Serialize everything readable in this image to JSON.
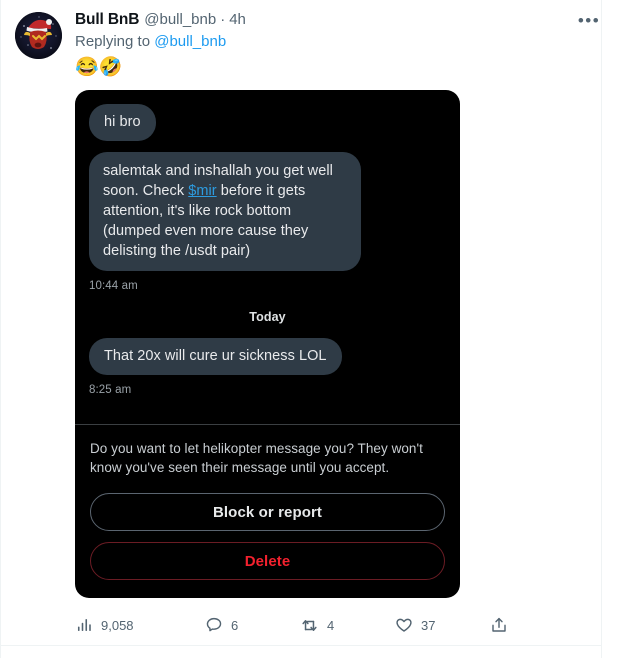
{
  "tweet": {
    "display_name": "Bull BnB",
    "handle": "@bull_bnb",
    "separator": "·",
    "timestamp": "4h",
    "more_label": "•••",
    "replying_prefix": "Replying to",
    "replying_handle": "@bull_bnb",
    "body_text": "😂🤣"
  },
  "media_card": {
    "messages": [
      {
        "text": "hi bro",
        "kind": "plain"
      },
      {
        "text_before_link": "salemtak and inshallah you get well soon. Check ",
        "link_text": "$mir",
        "text_after_link": " before it gets attention, it's like rock bottom (dumped even more cause they delisting the /usdt pair)",
        "kind": "with-link"
      }
    ],
    "first_time": "10:44 am",
    "day_divider": "Today",
    "second_message": "That 20x will cure ur sickness LOL",
    "second_time": "8:25 am",
    "accept_prompt": "Do you want to let helikopter message you? They won't know you've seen their message until you accept.",
    "block_button": "Block or report",
    "delete_button": "Delete",
    "colors": {
      "card_background": "#000000",
      "bubble": "#2f3b46",
      "link": "#2d9ce0",
      "delete": "#f4212e",
      "separator": "#3b3f42"
    }
  },
  "actions": {
    "views": {
      "icon": "bar-chart-icon",
      "count": "9,058"
    },
    "reply": {
      "icon": "reply-icon",
      "count": "6"
    },
    "retweet": {
      "icon": "retweet-icon",
      "count": "4"
    },
    "like": {
      "icon": "heart-icon",
      "count": "37"
    },
    "share": {
      "icon": "share-icon",
      "count": ""
    }
  },
  "theme": {
    "accent": "#1d9bf0",
    "text_primary": "#0f1419",
    "text_secondary": "#536471",
    "border": "#eff3f4"
  }
}
